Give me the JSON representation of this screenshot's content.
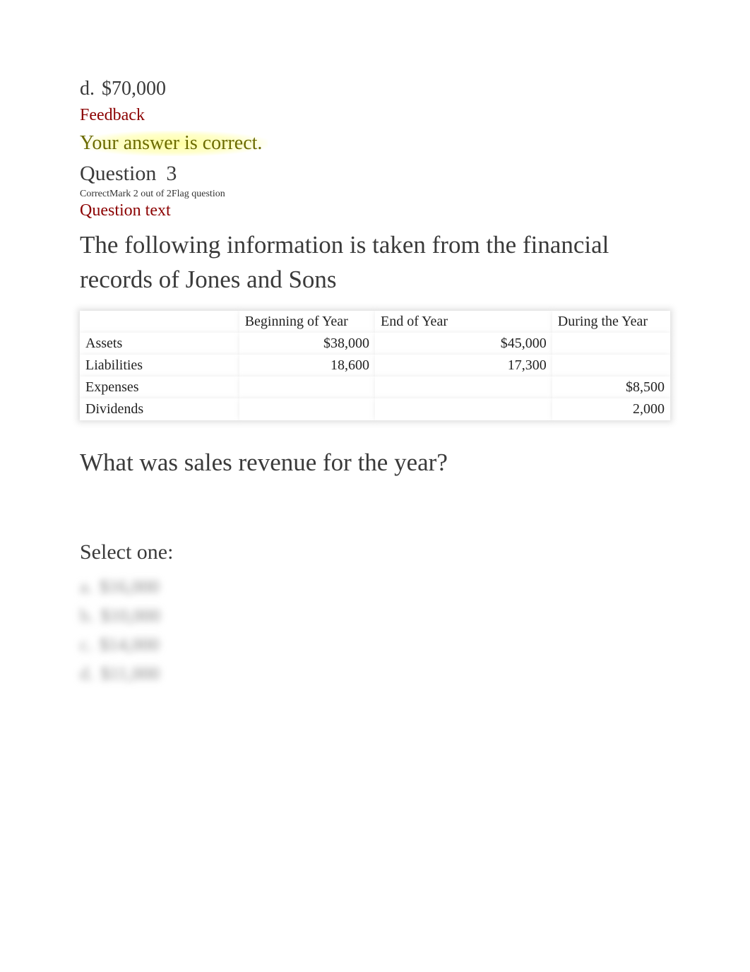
{
  "prev_option": {
    "letter": "d.",
    "value": "$70,000"
  },
  "feedback": {
    "label": "Feedback",
    "message": "Your answer is correct."
  },
  "question": {
    "label": "Question",
    "number": "3",
    "meta_correct": "Correct",
    "meta_mark": "Mark 2 out of 2",
    "meta_flag": "Flag question",
    "text_label": "Question text",
    "body": "The following information is taken from the financial records of Jones and Sons",
    "sub_question": "What was sales revenue for the year?",
    "select_one": "Select one:"
  },
  "table": {
    "headers": {
      "c0": "",
      "c1": "Beginning of Year",
      "c2": "End of Year",
      "c3": "During the Year"
    },
    "rows": [
      {
        "label": "Assets",
        "c1": "$38,000",
        "c2": "$45,000",
        "c3": ""
      },
      {
        "label": "Liabilities",
        "c1": "18,600",
        "c2": "17,300",
        "c3": ""
      },
      {
        "label": "Expenses",
        "c1": "",
        "c2": "",
        "c3": "$8,500"
      },
      {
        "label": "Dividends",
        "c1": "",
        "c2": "",
        "c3": "2,000"
      }
    ]
  },
  "blurred_options": [
    {
      "letter": "a.",
      "value": "$16,000"
    },
    {
      "letter": "b.",
      "value": "$10,000"
    },
    {
      "letter": "c.",
      "value": "$14,000"
    },
    {
      "letter": "d.",
      "value": "$11,000"
    }
  ]
}
